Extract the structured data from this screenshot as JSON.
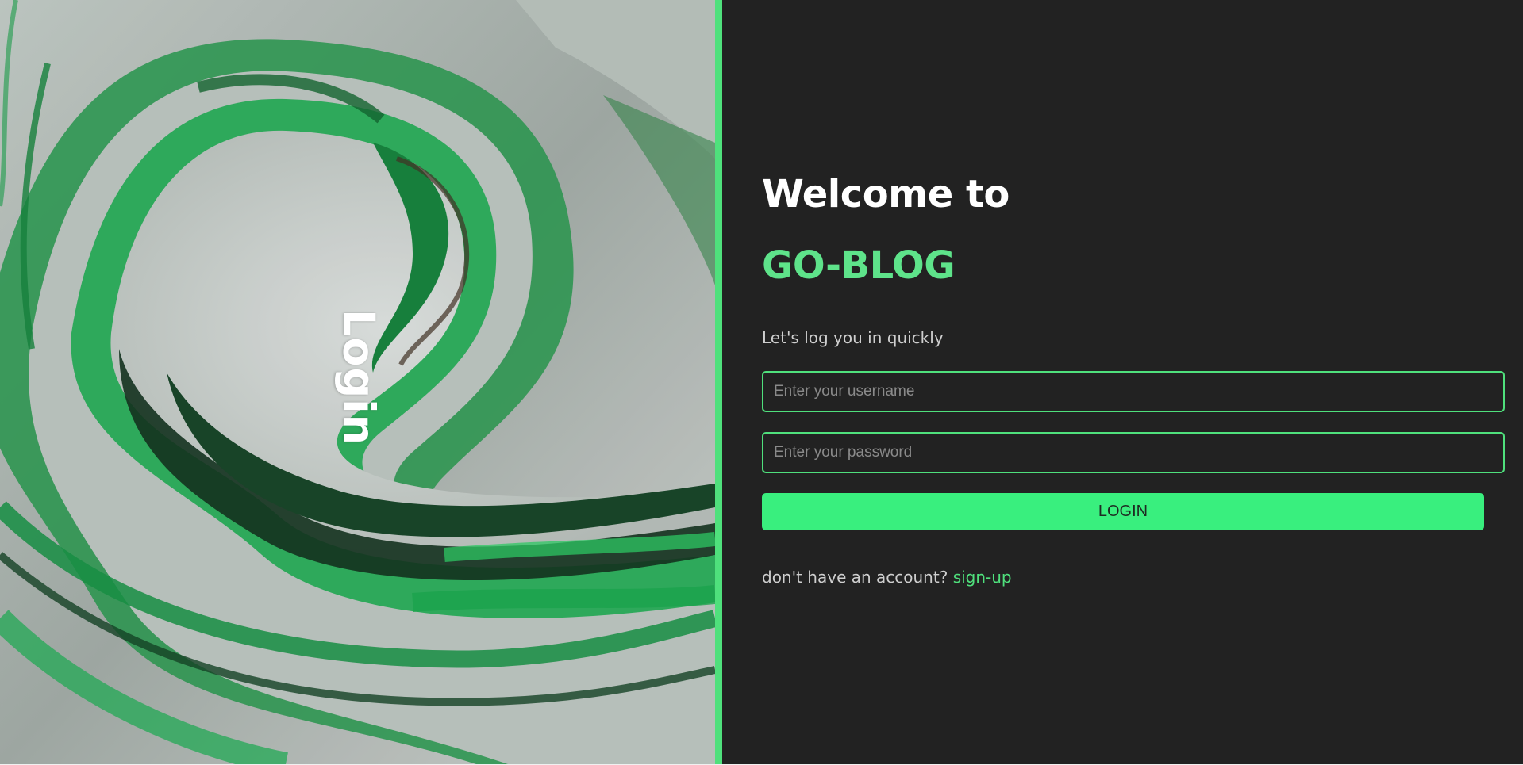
{
  "hero": {
    "vertical_title": "Login",
    "image": "green-marble-texture"
  },
  "form": {
    "welcome": "Welcome to",
    "brand": "GO-BLOG",
    "subtitle": "Let's log you in quickly",
    "username_placeholder": "Enter your username",
    "password_placeholder": "Enter your password",
    "login_label": "LOGIN",
    "signup_prompt": "don't have an account?",
    "signup_link": "sign-up"
  },
  "colors": {
    "accent": "#4fe07c",
    "button": "#39ef7e",
    "panel_bg": "#222222",
    "brand_text": "#5ee38a"
  }
}
